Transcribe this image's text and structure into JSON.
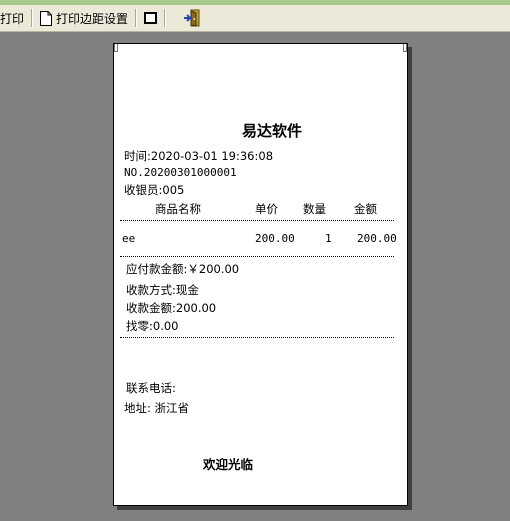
{
  "toolbar": {
    "print_label": "打印",
    "margin_label": "打印边距设置"
  },
  "receipt": {
    "company": "易达软件",
    "time": "时间:2020-03-01 19:36:08",
    "order_no": "NO.20200301000001",
    "cashier": "收银员:005",
    "columns": {
      "name": "商品名称",
      "price": "单价",
      "qty": "数量",
      "amount": "金额"
    },
    "items": [
      {
        "name": "ee",
        "price": "200.00",
        "qty": "1",
        "amount": "200.00"
      }
    ],
    "payable": "应付款金额:￥200.00",
    "pay_method": "收款方式:现金",
    "received": "收款金额:200.00",
    "change": "找零:0.00",
    "phone": "联系电话:",
    "address": "地址: 浙江省",
    "welcome": "欢迎光临"
  }
}
